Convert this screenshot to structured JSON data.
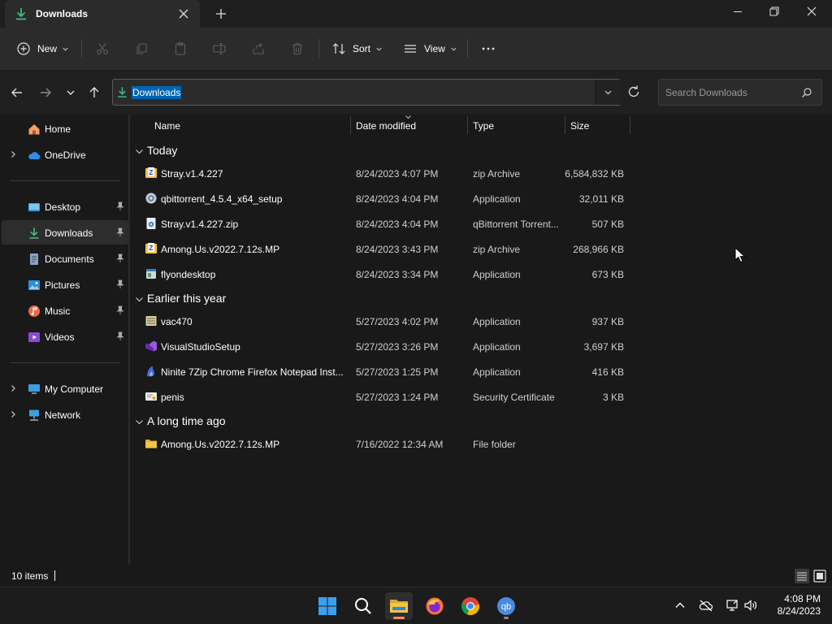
{
  "tab": {
    "title": "Downloads"
  },
  "commands": {
    "new_label": "New",
    "sort_label": "Sort",
    "view_label": "View"
  },
  "address": {
    "path": "Downloads"
  },
  "search": {
    "placeholder": "Search Downloads"
  },
  "sidebar": {
    "items": [
      {
        "label": "Home"
      },
      {
        "label": "OneDrive"
      },
      {
        "label": "Desktop"
      },
      {
        "label": "Downloads"
      },
      {
        "label": "Documents"
      },
      {
        "label": "Pictures"
      },
      {
        "label": "Music"
      },
      {
        "label": "Videos"
      },
      {
        "label": "My Computer"
      },
      {
        "label": "Network"
      }
    ]
  },
  "columns": {
    "name": "Name",
    "date": "Date modified",
    "type": "Type",
    "size": "Size"
  },
  "groups": [
    {
      "label": "Today",
      "files": [
        {
          "name": "Stray.v1.4.227",
          "date": "8/24/2023 4:07 PM",
          "type": "zip Archive",
          "size": "6,584,832 KB",
          "icon": "zip-archive-icon"
        },
        {
          "name": "qbittorrent_4.5.4_x64_setup",
          "date": "8/24/2023 4:04 PM",
          "type": "Application",
          "size": "32,011 KB",
          "icon": "installer-icon"
        },
        {
          "name": "Stray.v1.4.227.zip",
          "date": "8/24/2023 4:04 PM",
          "type": "qBittorrent Torrent...",
          "size": "507 KB",
          "icon": "torrent-file-icon"
        },
        {
          "name": "Among.Us.v2022.7.12s.MP",
          "date": "8/24/2023 3:43 PM",
          "type": "zip Archive",
          "size": "268,966 KB",
          "icon": "zip-archive-icon"
        },
        {
          "name": "flyondesktop",
          "date": "8/24/2023 3:34 PM",
          "type": "Application",
          "size": "673 KB",
          "icon": "application-icon"
        }
      ]
    },
    {
      "label": "Earlier this year",
      "files": [
        {
          "name": "vac470",
          "date": "5/27/2023 4:02 PM",
          "type": "Application",
          "size": "937 KB",
          "icon": "application-icon"
        },
        {
          "name": "VisualStudioSetup",
          "date": "5/27/2023 3:26 PM",
          "type": "Application",
          "size": "3,697 KB",
          "icon": "visual-studio-icon"
        },
        {
          "name": "Ninite 7Zip Chrome Firefox Notepad Inst...",
          "date": "5/27/2023 1:25 PM",
          "type": "Application",
          "size": "416 KB",
          "icon": "ninite-icon"
        },
        {
          "name": "penis",
          "date": "5/27/2023 1:24 PM",
          "type": "Security Certificate",
          "size": "3 KB",
          "icon": "certificate-icon"
        }
      ]
    },
    {
      "label": "A long time ago",
      "files": [
        {
          "name": "Among.Us.v2022.7.12s.MP",
          "date": "7/16/2022 12:34 AM",
          "type": "File folder",
          "size": "",
          "icon": "folder-icon"
        }
      ]
    }
  ],
  "status": {
    "item_count": "10 items"
  },
  "clock": {
    "time": "4:08 PM",
    "date": "8/24/2023"
  },
  "colors": {
    "accent": "#0063b1",
    "download_green": "#3fbf7f",
    "folder_yellow": "#f4c542"
  }
}
